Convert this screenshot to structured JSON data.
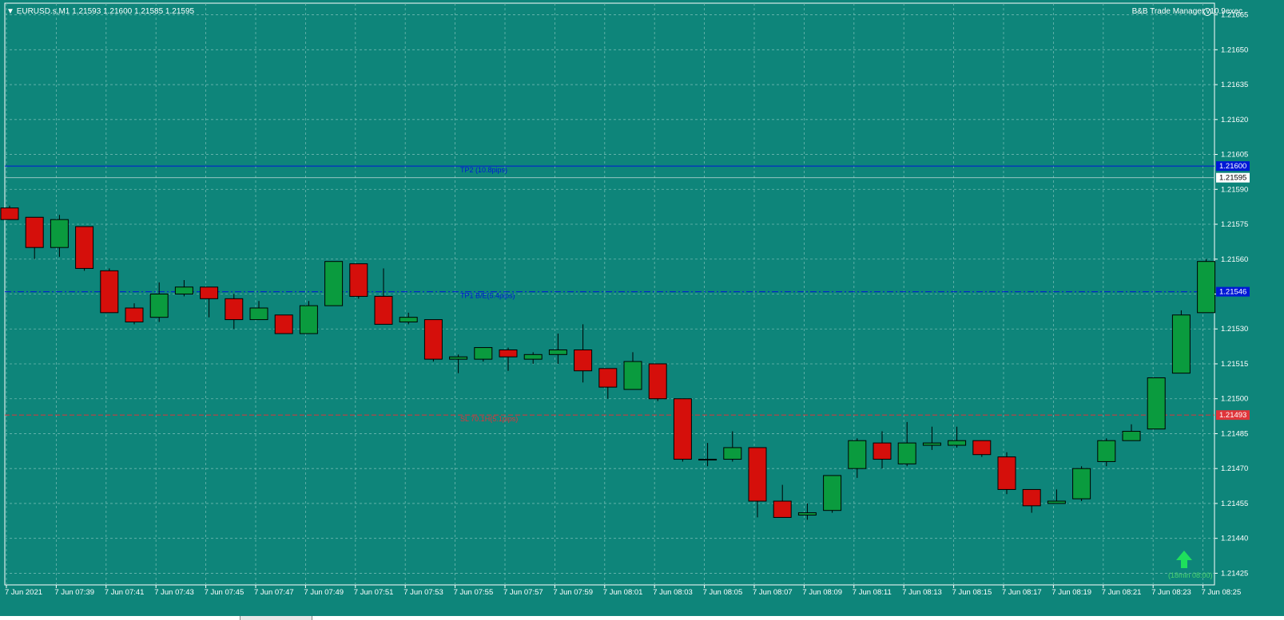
{
  "header": {
    "symbol_line": "EURUSD.s,M1  1.21593 1.21600 1.21585 1.21595",
    "ea_label": "B&B Trade Manager.v10.9exec"
  },
  "colors": {
    "background": "#0e857a",
    "grid": "#6fb9b1",
    "bull": "#0a9b3e",
    "bear": "#d50f0b",
    "tp_line": "#0018d6",
    "sl_line": "#e0343a",
    "axis_text": "#ffffff",
    "arrow": "#1ee05c"
  },
  "chart_data": {
    "type": "candlestick",
    "timeframe": "M1",
    "symbol": "EURUSD.s",
    "ylim": [
      1.2142,
      1.2167
    ],
    "y_ticks": [
      1.21665,
      1.2165,
      1.21635,
      1.2162,
      1.21605,
      1.2159,
      1.21575,
      1.2156,
      1.21545,
      1.2153,
      1.21515,
      1.215,
      1.21485,
      1.2147,
      1.21455,
      1.2144,
      1.21425
    ],
    "x_ticks": [
      "7 Jun 2021",
      "7 Jun 07:39",
      "7 Jun 07:41",
      "7 Jun 07:43",
      "7 Jun 07:45",
      "7 Jun 07:47",
      "7 Jun 07:49",
      "7 Jun 07:51",
      "7 Jun 07:53",
      "7 Jun 07:55",
      "7 Jun 07:57",
      "7 Jun 07:59",
      "7 Jun 08:01",
      "7 Jun 08:03",
      "7 Jun 08:05",
      "7 Jun 08:07",
      "7 Jun 08:09",
      "7 Jun 08:11",
      "7 Jun 08:13",
      "7 Jun 08:15",
      "7 Jun 08:17",
      "7 Jun 08:19",
      "7 Jun 08:21",
      "7 Jun 08:23",
      "7 Jun 08:25"
    ],
    "candles": [
      {
        "o": 1.21582,
        "h": 1.21583,
        "l": 1.21577,
        "c": 1.21577
      },
      {
        "o": 1.21578,
        "h": 1.21578,
        "l": 1.2156,
        "c": 1.21565
      },
      {
        "o": 1.21565,
        "h": 1.21579,
        "l": 1.21561,
        "c": 1.21577
      },
      {
        "o": 1.21574,
        "h": 1.21574,
        "l": 1.21555,
        "c": 1.21556
      },
      {
        "o": 1.21555,
        "h": 1.21556,
        "l": 1.21537,
        "c": 1.21537
      },
      {
        "o": 1.21539,
        "h": 1.21541,
        "l": 1.21532,
        "c": 1.21533
      },
      {
        "o": 1.21535,
        "h": 1.2155,
        "l": 1.21533,
        "c": 1.21545
      },
      {
        "o": 1.21545,
        "h": 1.21551,
        "l": 1.21544,
        "c": 1.21548
      },
      {
        "o": 1.21548,
        "h": 1.21548,
        "l": 1.21535,
        "c": 1.21543
      },
      {
        "o": 1.21543,
        "h": 1.21545,
        "l": 1.2153,
        "c": 1.21534
      },
      {
        "o": 1.21534,
        "h": 1.21542,
        "l": 1.21534,
        "c": 1.21539
      },
      {
        "o": 1.21536,
        "h": 1.21536,
        "l": 1.21528,
        "c": 1.21528
      },
      {
        "o": 1.21528,
        "h": 1.21542,
        "l": 1.21528,
        "c": 1.2154
      },
      {
        "o": 1.2154,
        "h": 1.21559,
        "l": 1.2154,
        "c": 1.21559
      },
      {
        "o": 1.21558,
        "h": 1.21558,
        "l": 1.21543,
        "c": 1.21544
      },
      {
        "o": 1.21544,
        "h": 1.21556,
        "l": 1.21532,
        "c": 1.21532
      },
      {
        "o": 1.21533,
        "h": 1.21537,
        "l": 1.21532,
        "c": 1.21535
      },
      {
        "o": 1.21534,
        "h": 1.21534,
        "l": 1.21516,
        "c": 1.21517
      },
      {
        "o": 1.21517,
        "h": 1.21519,
        "l": 1.21511,
        "c": 1.21518
      },
      {
        "o": 1.21517,
        "h": 1.21522,
        "l": 1.21516,
        "c": 1.21522
      },
      {
        "o": 1.21521,
        "h": 1.21522,
        "l": 1.21512,
        "c": 1.21518
      },
      {
        "o": 1.21517,
        "h": 1.2152,
        "l": 1.21515,
        "c": 1.21519
      },
      {
        "o": 1.21519,
        "h": 1.21528,
        "l": 1.21515,
        "c": 1.21521
      },
      {
        "o": 1.21521,
        "h": 1.21532,
        "l": 1.21507,
        "c": 1.21512
      },
      {
        "o": 1.21513,
        "h": 1.21513,
        "l": 1.215,
        "c": 1.21505
      },
      {
        "o": 1.21504,
        "h": 1.2152,
        "l": 1.21504,
        "c": 1.21516
      },
      {
        "o": 1.21515,
        "h": 1.21515,
        "l": 1.21499,
        "c": 1.215
      },
      {
        "o": 1.215,
        "h": 1.215,
        "l": 1.21473,
        "c": 1.21474
      },
      {
        "o": 1.21474,
        "h": 1.21481,
        "l": 1.21471,
        "c": 1.21474
      },
      {
        "o": 1.21474,
        "h": 1.21486,
        "l": 1.21473,
        "c": 1.21479
      },
      {
        "o": 1.21479,
        "h": 1.21479,
        "l": 1.21449,
        "c": 1.21456
      },
      {
        "o": 1.21456,
        "h": 1.21463,
        "l": 1.21449,
        "c": 1.21449
      },
      {
        "o": 1.2145,
        "h": 1.21455,
        "l": 1.21448,
        "c": 1.21451
      },
      {
        "o": 1.21452,
        "h": 1.21467,
        "l": 1.21451,
        "c": 1.21467
      },
      {
        "o": 1.2147,
        "h": 1.21483,
        "l": 1.21466,
        "c": 1.21482
      },
      {
        "o": 1.21481,
        "h": 1.21486,
        "l": 1.2147,
        "c": 1.21474
      },
      {
        "o": 1.21472,
        "h": 1.2149,
        "l": 1.21471,
        "c": 1.21481
      },
      {
        "o": 1.2148,
        "h": 1.21488,
        "l": 1.21478,
        "c": 1.21481
      },
      {
        "o": 1.2148,
        "h": 1.21488,
        "l": 1.21479,
        "c": 1.21482
      },
      {
        "o": 1.21482,
        "h": 1.21482,
        "l": 1.21475,
        "c": 1.21476
      },
      {
        "o": 1.21475,
        "h": 1.21477,
        "l": 1.21459,
        "c": 1.21461
      },
      {
        "o": 1.21461,
        "h": 1.21461,
        "l": 1.21451,
        "c": 1.21454
      },
      {
        "o": 1.21455,
        "h": 1.21461,
        "l": 1.21455,
        "c": 1.21456
      },
      {
        "o": 1.21457,
        "h": 1.21471,
        "l": 1.21456,
        "c": 1.2147
      },
      {
        "o": 1.21473,
        "h": 1.21483,
        "l": 1.21471,
        "c": 1.21482
      },
      {
        "o": 1.21482,
        "h": 1.21489,
        "l": 1.21482,
        "c": 1.21486
      },
      {
        "o": 1.21487,
        "h": 1.21509,
        "l": 1.21487,
        "c": 1.21509
      },
      {
        "o": 1.21511,
        "h": 1.21538,
        "l": 1.21511,
        "c": 1.21536
      },
      {
        "o": 1.21537,
        "h": 1.2156,
        "l": 1.21537,
        "c": 1.21559
      }
    ],
    "price_levels": [
      {
        "name": "TP2 (10.8pips)",
        "value": 1.216,
        "label": "1.21600",
        "style": "solid",
        "color": "#0018d6",
        "tag_bg": "#0018d6"
      },
      {
        "name": "TP1 B/E(5.4pips)",
        "value": 1.21546,
        "label": "1.21546",
        "style": "dashdot",
        "color": "#0018d6",
        "tag_bg": "#0018d6"
      },
      {
        "name": "SL 70.1H(5.1pips)",
        "value": 1.21493,
        "label": "1.21493",
        "style": "dashed",
        "color": "#e0343a",
        "tag_bg": "#e0343a"
      }
    ],
    "bid": {
      "value": 1.21595,
      "label": "1.21595"
    },
    "annotation": "(18min 08:00)"
  }
}
